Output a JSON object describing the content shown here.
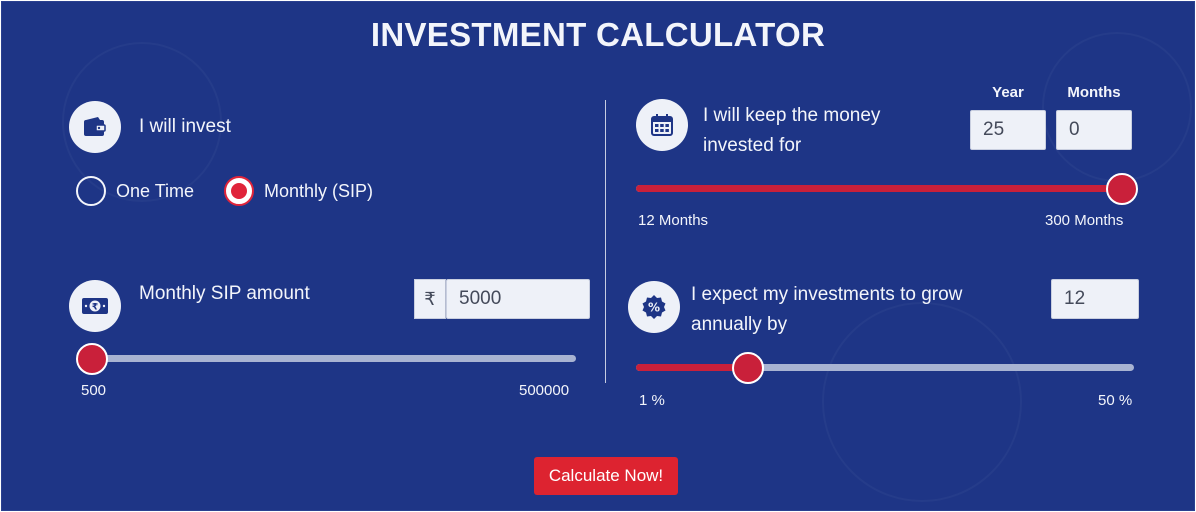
{
  "title": "INVESTMENT CALCULATOR",
  "invest": {
    "label": "I will invest",
    "icon": "wallet-icon",
    "options": [
      {
        "label": "One Time",
        "selected": false
      },
      {
        "label": "Monthly (SIP)",
        "selected": true
      }
    ]
  },
  "amount": {
    "label": "Monthly SIP amount",
    "icon": "rupee-note-icon",
    "currency_symbol": "₹",
    "value": "5000",
    "min_label": "500",
    "max_label": "500000",
    "slider_fraction": 0.009
  },
  "duration": {
    "label_line1": "I will keep the money",
    "label_line2": "invested for",
    "icon": "calendar-icon",
    "year_header": "Year",
    "months_header": "Months",
    "years_value": "25",
    "months_value": "0",
    "min_label": "12 Months",
    "max_label": "300 Months",
    "slider_fraction": 1.0
  },
  "growth": {
    "label_line1": "I expect my investments to grow",
    "label_line2": "annually by",
    "icon": "percent-icon",
    "value": "12",
    "min_label": "1 %",
    "max_label": "50 %",
    "slider_fraction": 0.2245
  },
  "calculate_button": "Calculate Now!",
  "colors": {
    "background": "#1e3586",
    "accent": "#c9203a",
    "button": "#dd2330"
  }
}
